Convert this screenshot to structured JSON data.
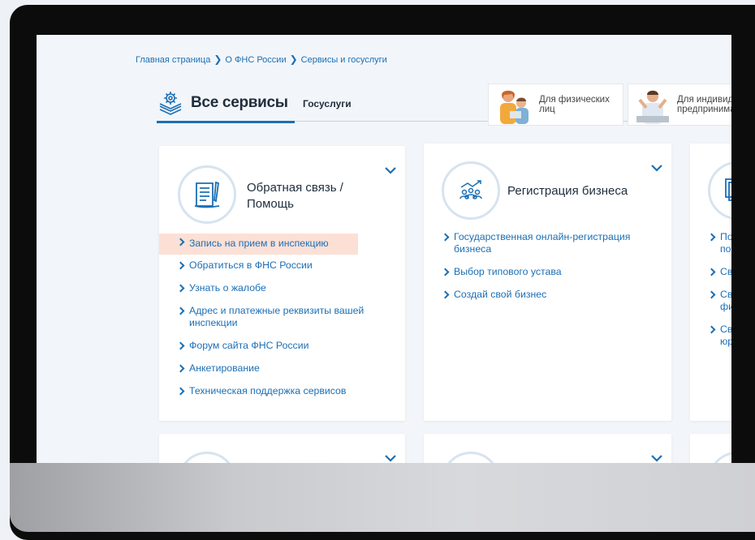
{
  "breadcrumb": {
    "items": [
      "Главная страница",
      "О ФНС России",
      "Сервисы и госуслуги"
    ],
    "separator": "❯"
  },
  "tabs": {
    "active": "Все сервисы",
    "secondary": "Госуслуги"
  },
  "segments": [
    {
      "label": "Для физических лиц"
    },
    {
      "label": "Для индивидуальных предпринимателей"
    }
  ],
  "cards": [
    {
      "title": "Обратная связь / Помощь",
      "icon": "document-pen-icon",
      "links": [
        "Запись на прием в инспекцию",
        "Обратиться в ФНС России",
        "Узнать о жалобе",
        "Адрес и платежные реквизиты вашей инспекции",
        "Форум сайта ФНС России",
        "Анкетирование",
        "Техническая поддержка сервисов"
      ],
      "highlighted_index": 0
    },
    {
      "title": "Регистрация бизнеса",
      "icon": "business-growth-icon",
      "links": [
        "Государственная онлайн-регистрация бизнеса",
        "Выбор типового устава",
        "Создай свой бизнес"
      ]
    },
    {
      "title": "",
      "icon": "document-stack-icon",
      "links": [
        "По по",
        "Св",
        "Св фи",
        "Св юр"
      ]
    }
  ],
  "colors": {
    "accent": "#1b6fb5",
    "highlight": "#fce0d6",
    "text_dark": "#1f2d3d"
  }
}
